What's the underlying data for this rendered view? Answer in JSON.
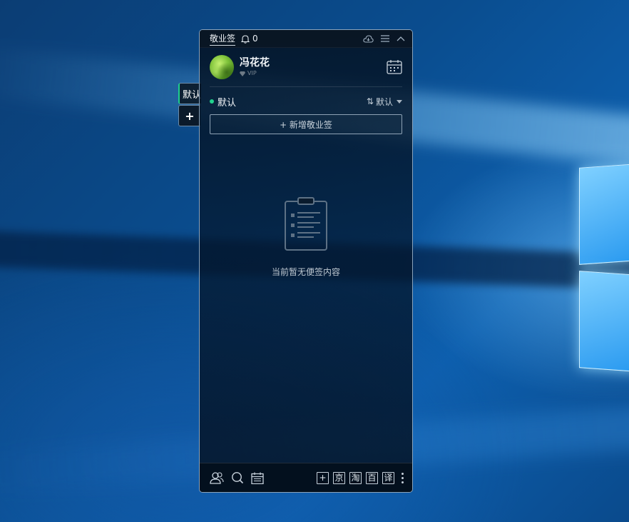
{
  "app": {
    "title": "敬业签",
    "notification_count": "0"
  },
  "user": {
    "name": "冯花花",
    "badge": "VIP"
  },
  "side_tabs": {
    "active_label": "默认",
    "add_label": "+"
  },
  "group": {
    "name": "默认",
    "sort_label": "默认",
    "sort_prefix": "⇅"
  },
  "add_note_label": "+ 新增敬业签",
  "empty_text": "当前暂无便签内容",
  "bottom_tools": {
    "add": "+",
    "jd": "京",
    "taobao": "淘",
    "baidu": "百",
    "translate": "译"
  },
  "colors": {
    "accent": "#22d28e",
    "border": "#8aa3bb"
  }
}
